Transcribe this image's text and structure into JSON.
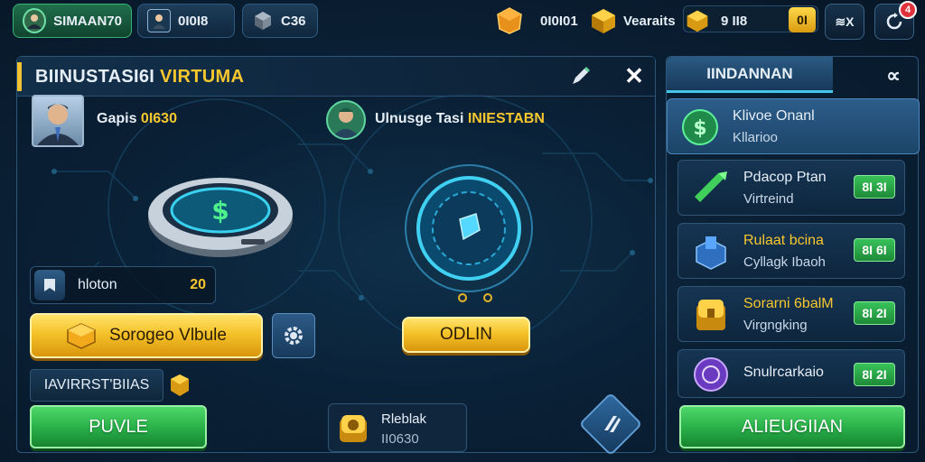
{
  "topbar": {
    "player_name": "SIMAAN70",
    "stat1": "0I0I8",
    "stat2": "C36",
    "gold_amount": "0I0I01",
    "resource_label": "Vearaits",
    "resource_value": "9 II8",
    "badge": "0I",
    "swap_label": "≋X",
    "notif_count": "4"
  },
  "panel": {
    "title_main": "BIINUSTASI6I",
    "title_accent": "VIRTUMA",
    "profile_label": "Gapis",
    "profile_value": "0I630",
    "opponent_label": "Ulnusge Tasi",
    "opponent_accent": "INIESTABN",
    "info_label": "hloton",
    "info_value": "20",
    "primary_button": "Sorogeo Vlbule",
    "center_button": "ODLIN",
    "subtab_label": "IAVIRRST'BIIAS",
    "green_button": "PUVLE",
    "reward_title": "Rleblak",
    "reward_value": "II0630"
  },
  "side": {
    "tab_label": "IINDANNAN",
    "close_label": "∝",
    "items": [
      {
        "title": "Klivoe Onanl",
        "subtitle": "Kllarioo",
        "price": ""
      },
      {
        "title": "Pdacop Ptan",
        "subtitle": "Virtreind",
        "price": "8I 3I"
      },
      {
        "title": "Rulaat bcina",
        "subtitle": "Cyllagk Ibaoh",
        "price": "8I 6I"
      },
      {
        "title": "Sorarni 6balM",
        "subtitle": "Virgngking",
        "price": "8I 2I"
      },
      {
        "title": "Snulrcarkaio",
        "subtitle": "",
        "price": "8I 2I"
      }
    ],
    "bottom_button": "ALIEUGIIAN"
  },
  "colors": {
    "accent_yellow": "#f7c72e",
    "accent_green": "#27ae48",
    "accent_cyan": "#43c6e8",
    "background": "#0b2238"
  }
}
